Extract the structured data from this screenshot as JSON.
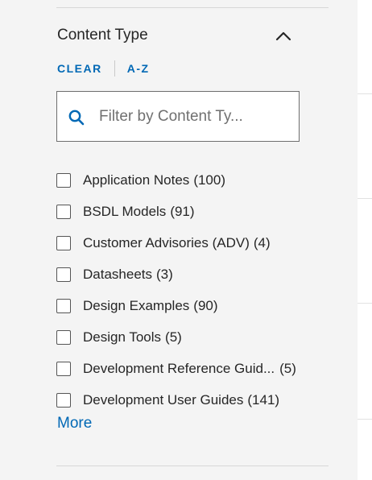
{
  "filter_panel": {
    "title": "Content Type",
    "clear_label": "CLEAR",
    "sort_label": "A-Z",
    "search": {
      "placeholder": "Filter by Content Ty...",
      "value": ""
    },
    "options": [
      {
        "label": "Application Notes",
        "count": "(100)",
        "checked": false
      },
      {
        "label": "BSDL Models",
        "count": "(91)",
        "checked": false
      },
      {
        "label": "Customer Advisories (ADV)",
        "count": "(4)",
        "checked": false
      },
      {
        "label": "Datasheets",
        "count": "(3)",
        "checked": false
      },
      {
        "label": "Design Examples",
        "count": "(90)",
        "checked": false
      },
      {
        "label": "Design Tools",
        "count": "(5)",
        "checked": false
      },
      {
        "label": "Development Reference Guid...",
        "count": "(5)",
        "checked": false
      },
      {
        "label": "Development User Guides",
        "count": "(141)",
        "checked": false
      }
    ],
    "more_label": "More"
  },
  "icons": {
    "collapse": "chevron-up-icon",
    "search": "search-icon"
  },
  "colors": {
    "link": "#0068b5",
    "background": "#f4f4f4",
    "text": "#262626"
  }
}
